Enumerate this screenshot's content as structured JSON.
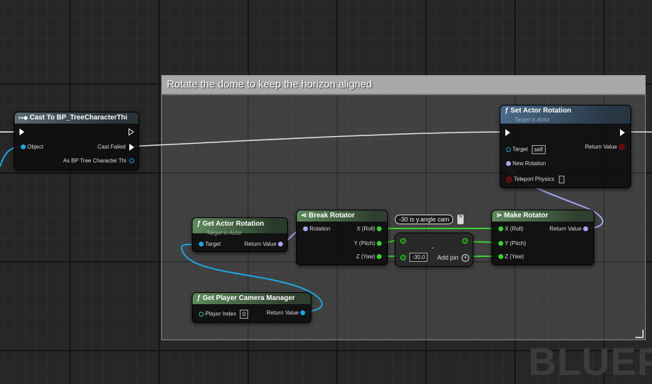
{
  "comment": {
    "title": "Rotate the dome to keep the horizon aligned"
  },
  "watermark": "BLUEPI",
  "cast_node": {
    "title": "Cast To BP_TreeCharacterThi",
    "input_object": "Object",
    "output_failed": "Cast Failed",
    "output_as": "As BP Tree Character Thi"
  },
  "set_actor_rotation": {
    "title": "Set Actor Rotation",
    "subtitle": "Target is Actor",
    "target_label": "Target",
    "target_value": "self",
    "return_value": "Return Value",
    "new_rotation": "New Rotation",
    "teleport_physics": "Teleport Physics"
  },
  "get_actor_rotation": {
    "title": "Get Actor Rotation",
    "subtitle": "Target is Actor",
    "target_label": "Target",
    "return_value": "Return Value"
  },
  "break_rotator": {
    "title": "Break Rotator",
    "input": "Rotation",
    "x": "X (Roll)",
    "y": "Y (Pitch)",
    "z": "Z (Yaw)"
  },
  "add_node": {
    "value": "-30,0",
    "add_pin": "Add pin",
    "tooltip": "-30 is y.angle cam"
  },
  "make_rotator": {
    "title": "Make Rotator",
    "x": "X (Roll)",
    "y": "Y (Pitch)",
    "z": "Z (Yaw)",
    "return_value": "Return Value"
  },
  "get_player_camera_manager": {
    "title": "Get Player Camera Manager",
    "player_index_label": "Player Index",
    "player_index_value": "0",
    "return_value": "Return Value"
  },
  "colors": {
    "exec": "#ffffff",
    "object": "#1fa8e6",
    "rotator": "#a2a7f6",
    "float": "#39d62f",
    "bool": "#8c1010",
    "comment": "#a9a9a9"
  }
}
